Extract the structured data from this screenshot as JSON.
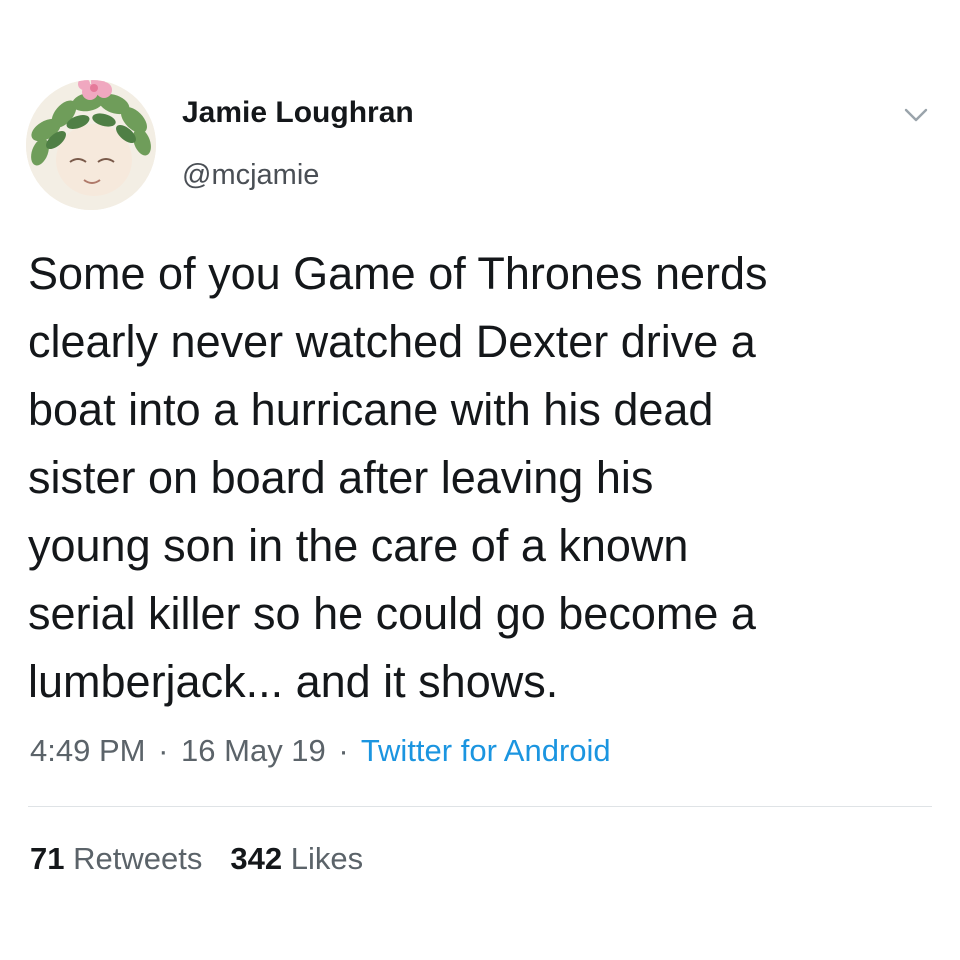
{
  "author": {
    "display_name": "Jamie Loughran",
    "handle": "@mcjamie",
    "avatar_icon": "avatar-icon"
  },
  "menu": {
    "icon": "chevron-down-icon"
  },
  "tweet": {
    "text": "Some of you Game of Thrones nerds\nclearly never watched Dexter drive a\nboat into a hurricane with his dead\nsister on board after leaving his\nyoung son in the care of a known\nserial killer so he could go become a\nlumberjack... and it shows.",
    "time": "4:49 PM",
    "date": "16 May 19",
    "separator": "·",
    "source": "Twitter for Android"
  },
  "stats": {
    "retweets_count": "71",
    "retweets_label": "Retweets",
    "likes_count": "342",
    "likes_label": "Likes"
  },
  "colors": {
    "text": "#14171a",
    "secondary": "#5b6369",
    "link": "#1b95e0",
    "divider": "#dfe3e6"
  }
}
